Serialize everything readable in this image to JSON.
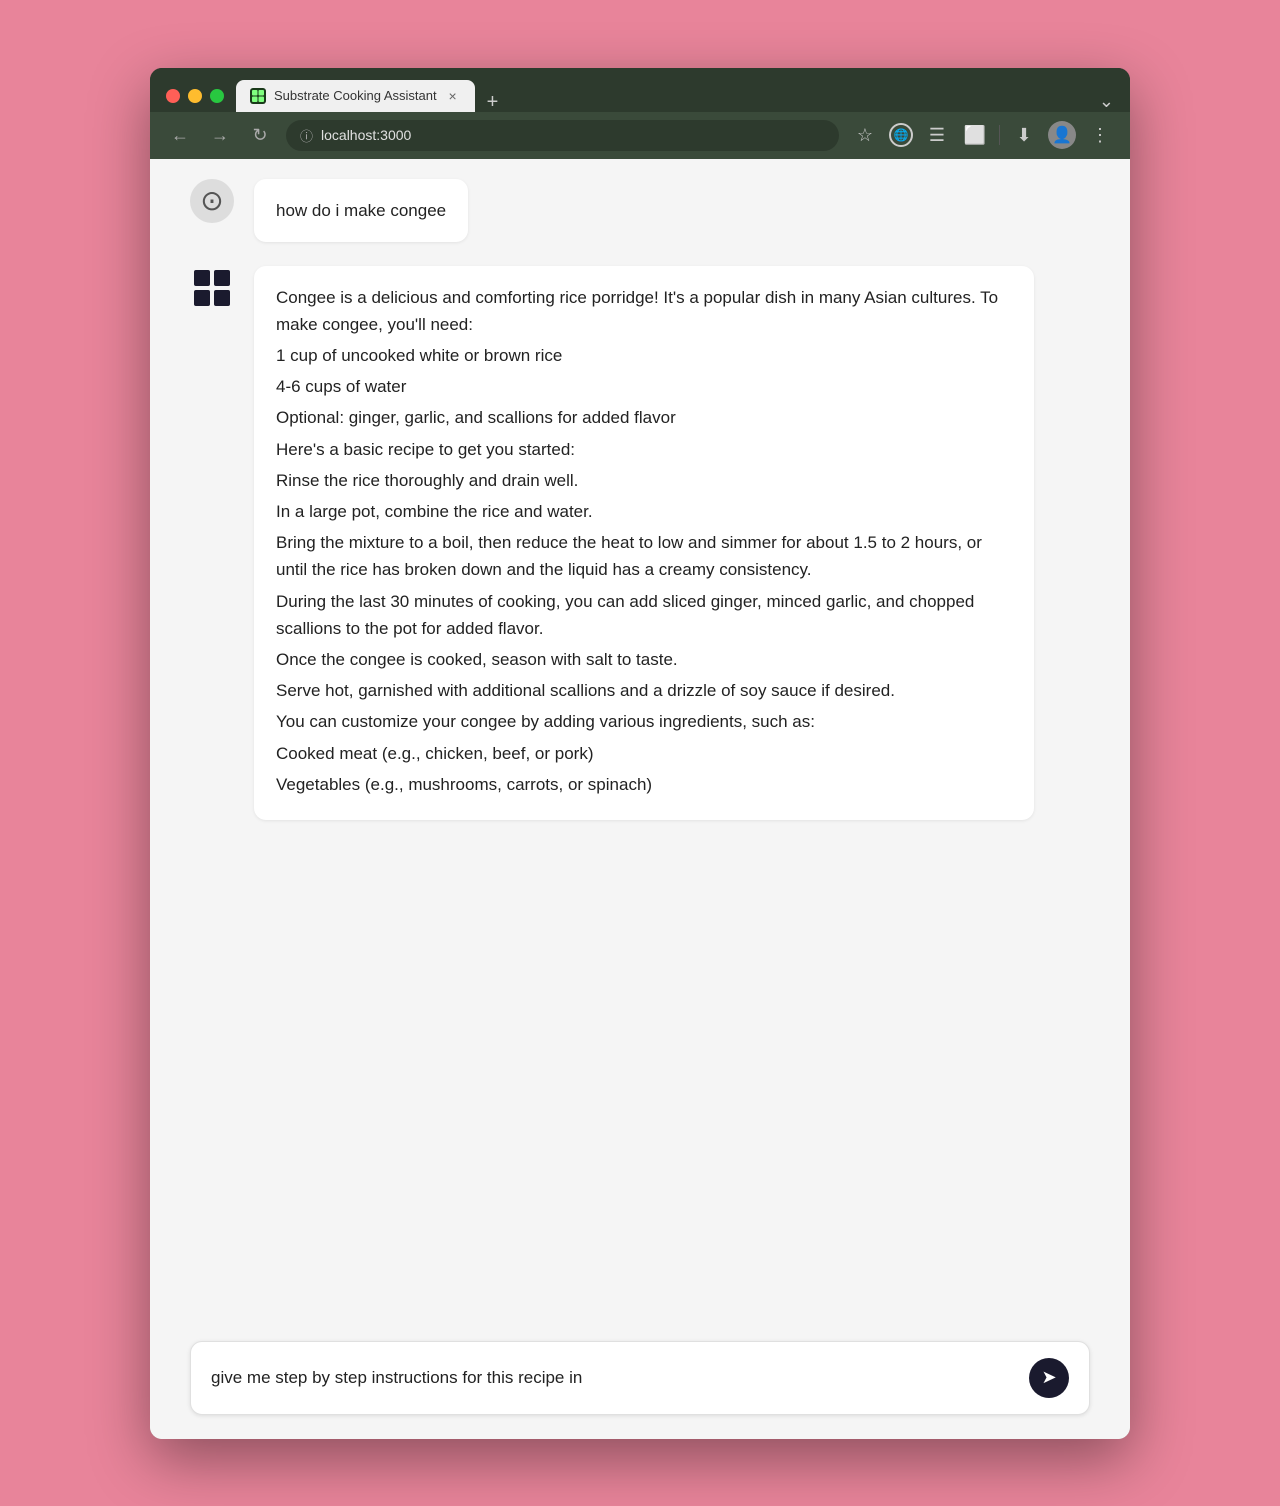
{
  "browser": {
    "tab_title": "Substrate Cooking Assistant",
    "tab_close_label": "×",
    "tab_new_label": "+",
    "tab_expand_label": "⌄",
    "url": "localhost:3000",
    "nav_back": "←",
    "nav_forward": "→",
    "nav_refresh": "↻",
    "menu_dots": "⋮"
  },
  "chat": {
    "user_message": "how do i make congee",
    "bot_response_lines": [
      "Congee is a delicious and comforting rice porridge! It's a popular dish in many Asian cultures. To make congee, you'll need:",
      "1 cup of uncooked white or brown rice",
      "4-6 cups of water",
      "Optional: ginger, garlic, and scallions for added flavor",
      "Here's a basic recipe to get you started:",
      "Rinse the rice thoroughly and drain well.",
      "In a large pot, combine the rice and water.",
      "Bring the mixture to a boil, then reduce the heat to low and simmer for about 1.5 to 2 hours, or until the rice has broken down and the liquid has a creamy consistency.",
      "During the last 30 minutes of cooking, you can add sliced ginger, minced garlic, and chopped scallions to the pot for added flavor.",
      "Once the congee is cooked, season with salt to taste.",
      "Serve hot, garnished with additional scallions and a drizzle of soy sauce if desired.",
      "You can customize your congee by adding various ingredients, such as:",
      "Cooked meat (e.g., chicken, beef, or pork)",
      "Vegetables (e.g., mushrooms, carrots, or spinach)"
    ]
  },
  "input": {
    "value": "give me step by step instructions for this recipe in ",
    "placeholder": ""
  }
}
